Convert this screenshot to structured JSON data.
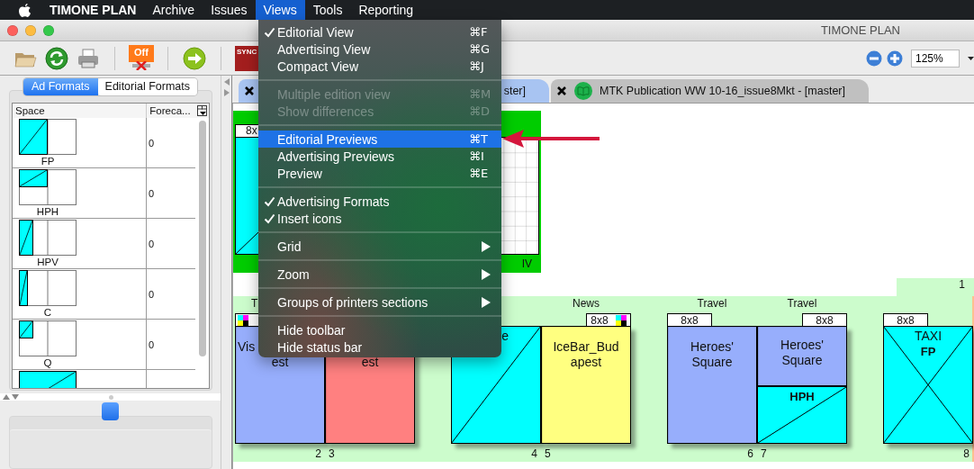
{
  "menubar": {
    "app_name": "TIMONE PLAN",
    "items": [
      {
        "label": "Archive",
        "selected": false
      },
      {
        "label": "Issues",
        "selected": false
      },
      {
        "label": "Views",
        "selected": true
      },
      {
        "label": "Tools",
        "selected": false
      },
      {
        "label": "Reporting",
        "selected": false
      }
    ]
  },
  "window": {
    "title": "TIMONE PLAN"
  },
  "toolbar": {
    "off_label": "Off",
    "sync_label": "SYNC",
    "zoom_field": {
      "value": "125%"
    }
  },
  "left_panel": {
    "tabs": [
      {
        "label": "Ad Formats",
        "selected": true
      },
      {
        "label": "Editorial Formats",
        "selected": false
      }
    ],
    "table": {
      "columns": [
        "Space",
        "Foreca..."
      ],
      "rows": [
        {
          "kind": "fp",
          "space": "FP",
          "forecast": "0"
        },
        {
          "kind": "hph",
          "space": "HPH",
          "forecast": "0"
        },
        {
          "kind": "hpv",
          "space": "HPV",
          "forecast": "0"
        },
        {
          "kind": "c",
          "space": "C",
          "forecast": "0"
        },
        {
          "kind": "q",
          "space": "Q",
          "forecast": "0"
        },
        {
          "kind": "wide"
        }
      ]
    }
  },
  "document_tabs": [
    {
      "label": "ster]",
      "selected": true,
      "icon": false
    },
    {
      "label": "MTK Publication WW 10-16_issue8Mkt - [master]",
      "selected": false,
      "icon": true
    }
  ],
  "canvas": {
    "top_spread": {
      "header": "8x",
      "folio": "IV"
    },
    "page_one": {
      "folio": "1"
    },
    "spreads": [
      {
        "pages": [
          {
            "kind": "grid",
            "color": "#97aefc",
            "section": {
              "kind": "fragment_start",
              "text": "T"
            },
            "header": {
              "cmyk": true
            },
            "texts": [
              {
                "kind": "fragment_start",
                "lines": [
                  "Vis"
                ]
              },
              {
                "kind": "centered",
                "lines": [
                  "est"
                ]
              }
            ],
            "folio": "2"
          },
          {
            "kind": "grid",
            "color": "#ff8080",
            "texts": [
              {
                "kind": "fragment_second_line",
                "lines": [
                  "est"
                ]
              }
            ],
            "folio": "3"
          }
        ]
      },
      {
        "pages": [
          {
            "kind": "ad",
            "texts": [
              {
                "kind": "fragment_end",
                "lines": [
                  "e"
                ]
              }
            ],
            "folio": "4"
          },
          {
            "kind": "grid",
            "color": "#ffff80",
            "section": {
              "kind": "centered",
              "text": "News"
            },
            "header": {
              "label": "8x8",
              "cmyk": true
            },
            "texts": [
              {
                "kind": "centered",
                "lines": [
                  "IceBar_Bud",
                  "apest"
                ]
              }
            ],
            "folio": "5"
          }
        ]
      },
      {
        "pages": [
          {
            "kind": "grid",
            "color": "#97aefc",
            "section": {
              "kind": "centered",
              "text": "Travel"
            },
            "header": {
              "label": "8x8",
              "cmyk": false
            },
            "texts": [
              {
                "kind": "centered",
                "lines": [
                  "Heroes'",
                  "Square"
                ]
              }
            ],
            "folio": "6"
          },
          {
            "kind": "split",
            "color": "#97aefc",
            "section": {
              "kind": "centered",
              "text": "Travel"
            },
            "header": {
              "label": "8x8",
              "cmyk": false
            },
            "texts": [
              {
                "kind": "centered",
                "lines": [
                  "Heroes'",
                  "Square"
                ]
              }
            ],
            "ad_label": "HPH",
            "folio": "7"
          }
        ]
      },
      {
        "pages": [
          {
            "kind": "full_ad",
            "header": {
              "label": "8x8",
              "cmyk": false
            },
            "texts": [
              {
                "kind": "centered",
                "lines": [
                  "TAXI"
                ]
              }
            ],
            "ad_label": "FP",
            "folio": "8"
          }
        ]
      }
    ]
  },
  "views_menu": [
    {
      "kind": "item",
      "label": "Editorial View",
      "shortcut": "⌘F",
      "checked": true,
      "disabled": false,
      "selected": false,
      "submenu": false
    },
    {
      "kind": "item",
      "label": "Advertising View",
      "shortcut": "⌘G",
      "checked": false,
      "disabled": false,
      "selected": false,
      "submenu": false
    },
    {
      "kind": "item",
      "label": "Compact View",
      "shortcut": "⌘J",
      "checked": false,
      "disabled": false,
      "selected": false,
      "submenu": false
    },
    {
      "kind": "separator"
    },
    {
      "kind": "item",
      "label": "Multiple edition view",
      "shortcut": "⌘M",
      "checked": false,
      "disabled": true,
      "selected": false,
      "submenu": false
    },
    {
      "kind": "item",
      "label": "Show differences",
      "shortcut": "⌘D",
      "checked": false,
      "disabled": true,
      "selected": false,
      "submenu": false
    },
    {
      "kind": "separator"
    },
    {
      "kind": "item",
      "label": "Editorial Previews",
      "shortcut": "⌘T",
      "checked": false,
      "disabled": false,
      "selected": true,
      "submenu": false
    },
    {
      "kind": "item",
      "label": "Advertising Previews",
      "shortcut": "⌘I",
      "checked": false,
      "disabled": false,
      "selected": false,
      "submenu": false
    },
    {
      "kind": "item",
      "label": "Preview",
      "shortcut": "⌘E",
      "checked": false,
      "disabled": false,
      "selected": false,
      "submenu": false
    },
    {
      "kind": "separator"
    },
    {
      "kind": "item",
      "label": "Advertising Formats",
      "checked": true,
      "disabled": false,
      "selected": false,
      "submenu": false
    },
    {
      "kind": "item",
      "label": "Insert icons",
      "checked": true,
      "disabled": false,
      "selected": false,
      "submenu": false
    },
    {
      "kind": "separator"
    },
    {
      "kind": "item",
      "label": "Grid",
      "checked": false,
      "disabled": false,
      "selected": false,
      "submenu": true
    },
    {
      "kind": "separator"
    },
    {
      "kind": "item",
      "label": "Zoom",
      "checked": false,
      "disabled": false,
      "selected": false,
      "submenu": true
    },
    {
      "kind": "separator"
    },
    {
      "kind": "item",
      "label": "Groups of printers sections",
      "checked": false,
      "disabled": false,
      "selected": false,
      "submenu": true
    },
    {
      "kind": "separator"
    },
    {
      "kind": "item",
      "label": "Hide toolbar",
      "checked": false,
      "disabled": false,
      "selected": false,
      "submenu": false
    },
    {
      "kind": "item",
      "label": "Hide status bar",
      "checked": false,
      "disabled": false,
      "selected": false,
      "submenu": false
    }
  ]
}
